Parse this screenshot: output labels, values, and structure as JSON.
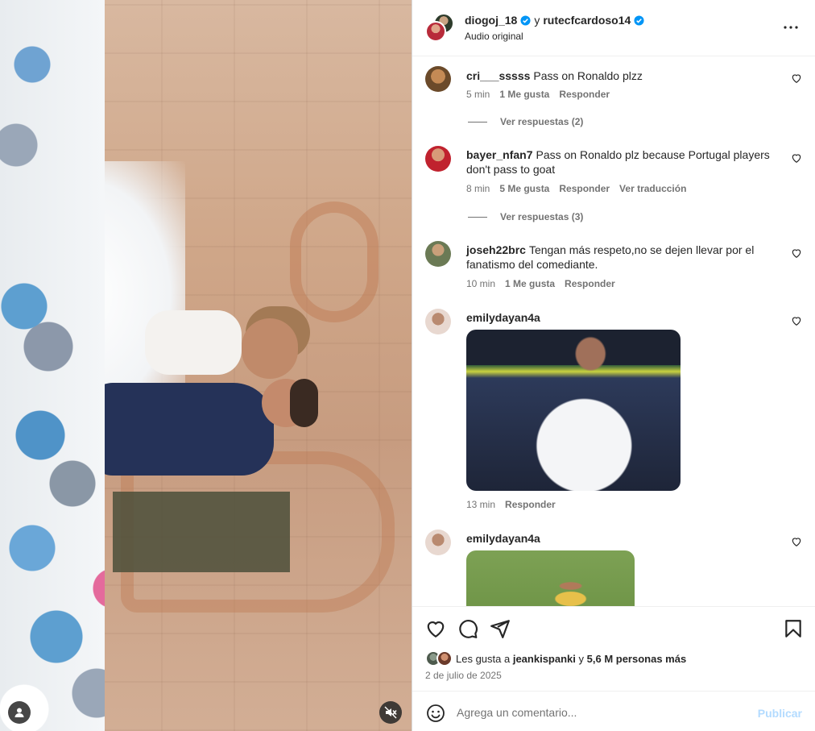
{
  "post": {
    "author_1": "diogoj_18",
    "connector": "y",
    "author_2": "rutecfcardoso14",
    "audio": "Audio original"
  },
  "comments": [
    {
      "user": "cri___sssss",
      "text": "Pass on Ronaldo plzz",
      "time": "5 min",
      "likes": "1 Me gusta",
      "reply": "Responder",
      "replies": "Ver respuestas (2)"
    },
    {
      "user": "bayer_nfan7",
      "text": "Pass on Ronaldo plz because Portugal players don't pass to goat",
      "time": "8 min",
      "likes": "5 Me gusta",
      "reply": "Responder",
      "translate": "Ver traducción",
      "replies": "Ver respuestas (3)"
    },
    {
      "user": "joseh22brc",
      "text": "Tengan más respeto,no se dejen llevar por el fanatismo del comediante.",
      "time": "10 min",
      "likes": "1 Me gusta",
      "reply": "Responder"
    },
    {
      "user": "emilydayan4a",
      "time": "13 min",
      "reply": "Responder"
    },
    {
      "user": "emilydayan4a"
    }
  ],
  "likes": {
    "prefix": "Les gusta a",
    "user": "jeankispanki",
    "connector": "y",
    "others": "5,6 M personas más"
  },
  "date": "2 de julio de 2025",
  "add_comment": {
    "placeholder": "Agrega un comentario...",
    "publish": "Publicar"
  },
  "colors": {
    "verified": "#0095f6",
    "publish_disabled": "#b3dbff",
    "secondary_text": "#737373"
  }
}
